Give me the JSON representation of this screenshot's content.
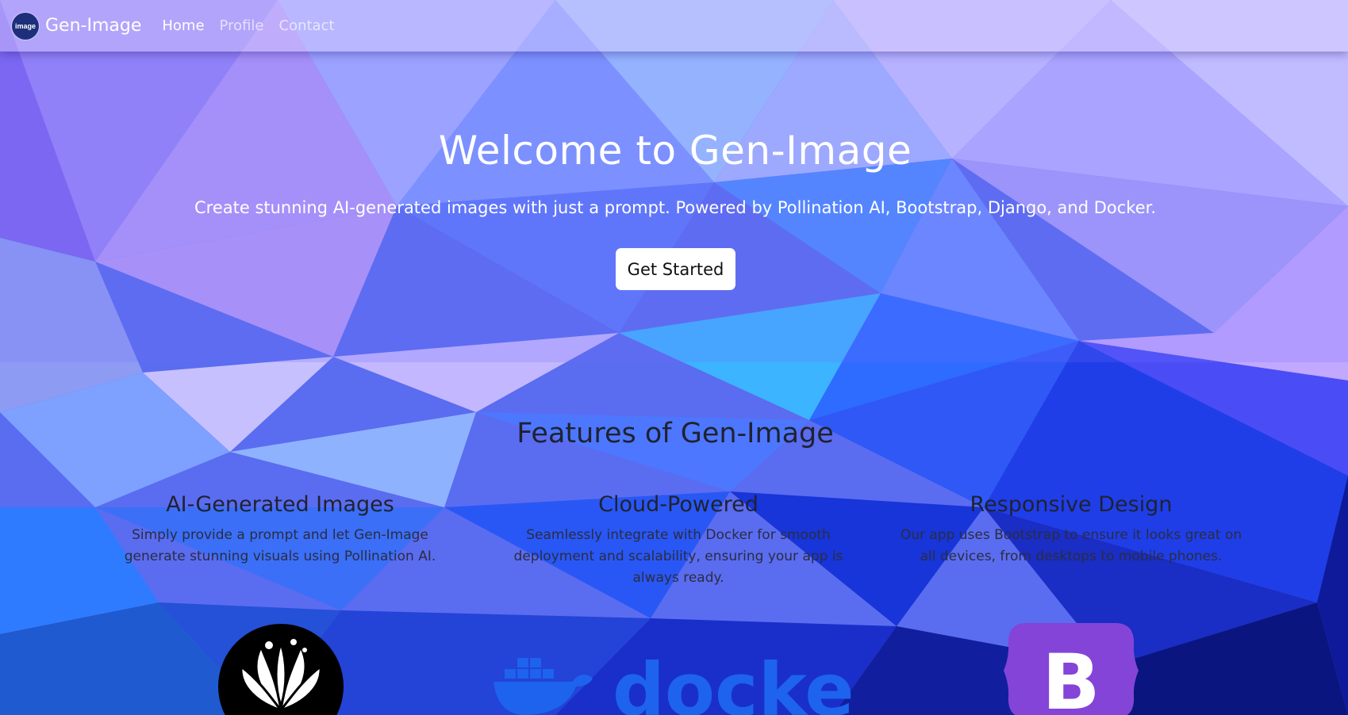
{
  "navbar": {
    "brand_logo_text": "image",
    "brand_name": "Gen-Image",
    "links": [
      {
        "label": "Home",
        "active": true
      },
      {
        "label": "Profile",
        "active": false
      },
      {
        "label": "Contact",
        "active": false
      }
    ]
  },
  "hero": {
    "title": "Welcome to Gen-Image",
    "subtitle": "Create stunning AI-generated images with just a prompt. Powered by Pollination AI, Bootstrap, Django, and Docker.",
    "cta_label": "Get Started"
  },
  "features": {
    "title": "Features of Gen-Image",
    "items": [
      {
        "title": "AI-Generated Images",
        "description": "Simply provide a prompt and let Gen-Image generate stunning visuals using Pollination AI.",
        "icon": "pollination-logo"
      },
      {
        "title": "Cloud-Powered",
        "description": "Seamlessly integrate with Docker for smooth deployment and scalability, ensuring your app is always ready.",
        "icon": "docker-logo",
        "logo_text": "docker"
      },
      {
        "title": "Responsive Design",
        "description": "Our app uses Bootstrap to ensure it looks great on all devices, from desktops to mobile phones.",
        "icon": "bootstrap-logo",
        "logo_text": "B"
      }
    ]
  },
  "colors": {
    "navbar_tint": "#c8beff",
    "docker_blue": "#1d63ed",
    "bootstrap_purple": "#7952b3"
  }
}
